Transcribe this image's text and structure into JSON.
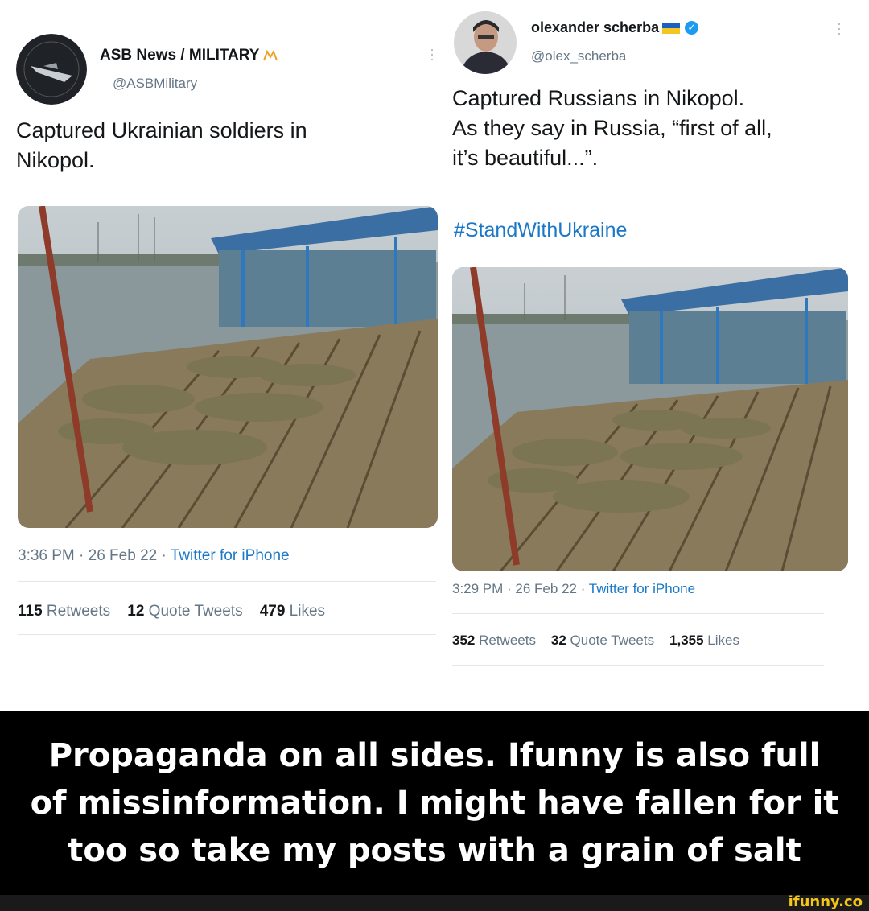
{
  "left_tweet": {
    "author": "ASB News / MILITARY",
    "handle": "@ASBMilitary",
    "text_lines": [
      "Captured Ukrainian soldiers in",
      "Nikopol."
    ],
    "timestamp": "3:36 PM · 26 Feb 22 · ",
    "source": "Twitter for iPhone",
    "retweets_count": "115",
    "retweets_label": " Retweets",
    "quotes_count": "12",
    "quotes_label": " Quote Tweets",
    "likes_count": "479",
    "likes_label": " Likes"
  },
  "right_tweet": {
    "author": "olexander scherba",
    "handle": "@olex_scherba",
    "text_lines": [
      "Captured Russians in Nikopol.",
      "As they say in Russia, “first of all,",
      "it’s beautiful...”."
    ],
    "hashtag": "#StandWithUkraine",
    "timestamp": "3:29 PM · 26 Feb 22 · ",
    "source": "Twitter for iPhone",
    "retweets_count": "352",
    "retweets_label": " Retweets",
    "quotes_count": "32",
    "quotes_label": " Quote Tweets",
    "likes_count": "1,355",
    "likes_label": " Likes"
  },
  "caption": {
    "lines": [
      "Propaganda on all sides. Ifunny is also full",
      "of missinformation. I might have fallen for it",
      "too so take my posts with a grain of salt"
    ]
  },
  "watermark": "ifunny.co",
  "colors": {
    "link": "#1b78c8",
    "verified": "#1d9bf0",
    "caption_bg": "#000000",
    "watermark": "#f5c518"
  },
  "icons": {
    "verified": "verified-badge-icon",
    "flag": "ukraine-flag-icon",
    "menu": "more-menu-icon"
  }
}
